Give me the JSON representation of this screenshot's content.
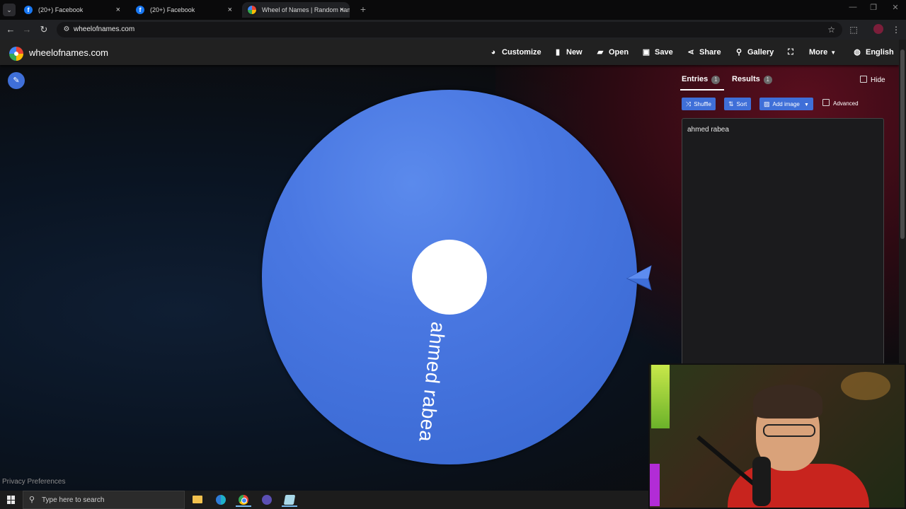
{
  "browser": {
    "tabs": [
      {
        "title": "(20+) Facebook",
        "icon": "facebook-icon",
        "active": false
      },
      {
        "title": "(20+) Facebook",
        "icon": "facebook-icon",
        "active": false
      },
      {
        "title": "Wheel of Names | Random nam",
        "icon": "wheel-icon",
        "active": true
      }
    ],
    "tab_close": "×",
    "new_tab": "+",
    "tab_menu": "⌄",
    "window_controls": {
      "minimize": "—",
      "maximize": "❐",
      "close": "✕"
    },
    "nav": {
      "back": "←",
      "forward": "→",
      "reload": "↻"
    },
    "url": "wheelofnames.com",
    "site_icon": "⚙",
    "star": "☆",
    "extensions": "⬚",
    "menu": "⋮"
  },
  "app": {
    "logo": "wheelofnames.com",
    "menu": [
      {
        "label": "Customize",
        "icon": "palette-icon",
        "glyph": "◕"
      },
      {
        "label": "New",
        "icon": "file-icon",
        "glyph": "▮"
      },
      {
        "label": "Open",
        "icon": "folder-open-icon",
        "glyph": "▰"
      },
      {
        "label": "Save",
        "icon": "save-icon",
        "glyph": "▣"
      },
      {
        "label": "Share",
        "icon": "share-icon",
        "glyph": "⋖"
      },
      {
        "label": "Gallery",
        "icon": "search-icon",
        "glyph": "⚲"
      },
      {
        "label": "",
        "icon": "fullscreen-icon",
        "glyph": "⛶"
      },
      {
        "label": "More",
        "icon": "",
        "glyph": "",
        "caret": "▼"
      },
      {
        "label": "English",
        "icon": "globe-icon",
        "glyph": "◍"
      }
    ],
    "edit_glyph": "✎",
    "wheel": {
      "color": "#4a78e2",
      "entry_label": "ahmed rabea"
    },
    "panel": {
      "tab_entries": "Entries",
      "entries_count": "1",
      "tab_results": "Results",
      "results_count": "1",
      "hide_label": "Hide",
      "buttons": [
        {
          "label": "Shuffle",
          "icon": "shuffle-icon",
          "glyph": "⤨"
        },
        {
          "label": "Sort",
          "icon": "sort-icon",
          "glyph": "⇅"
        },
        {
          "label": "Add image",
          "icon": "image-icon",
          "glyph": "▨",
          "caret": "▼"
        }
      ],
      "advanced_label": "Advanced",
      "entries_text": "ahmed rabea"
    },
    "privacy": "Privacy Preferences",
    "accent": "#3f6fd8"
  },
  "taskbar": {
    "search_placeholder": "Type here to search",
    "search_glyph": "⚲"
  }
}
